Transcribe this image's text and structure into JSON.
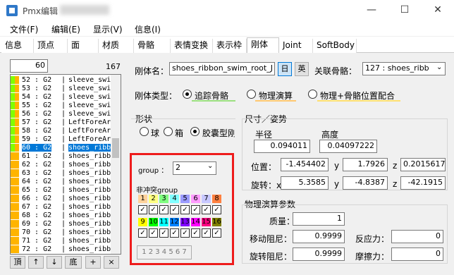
{
  "window": {
    "title": "Pmx编辑",
    "minimize": "—",
    "maximize": "☐",
    "close": "✕"
  },
  "menu": [
    "文件(F)",
    "编辑(E)",
    "显示(V)",
    "信息(I)"
  ],
  "tabs": [
    "信息",
    "顶点",
    "面",
    "材质",
    "骨骼",
    "表情变换",
    "表示枠",
    "刚体",
    "Joint",
    "SoftBody"
  ],
  "list": {
    "search_value": "60",
    "count": "167",
    "rows": [
      {
        "label": "52 : G2",
        "name": "sleeve_swi",
        "color": "#80ff00"
      },
      {
        "label": "53 : G2",
        "name": "sleeve_swi",
        "color": "#80ff00"
      },
      {
        "label": "54 : G2",
        "name": "sleeve_swi",
        "color": "#80ff00"
      },
      {
        "label": "55 : G2",
        "name": "sleeve_swi",
        "color": "#80ff00"
      },
      {
        "label": "56 : G2",
        "name": "sleeve_swi",
        "color": "#80ff00"
      },
      {
        "label": "57 : G2",
        "name": "LeftForeAr",
        "color": "#80ff00"
      },
      {
        "label": "58 : G2",
        "name": "LeftForeAr",
        "color": "#80ff00"
      },
      {
        "label": "59 : G2",
        "name": "LeftForeAr",
        "color": "#80ff00"
      },
      {
        "label": "60 : G2",
        "name": "shoes_ribb",
        "color": "#80ff00"
      },
      {
        "label": "61 : G2",
        "name": "shoes_ribb",
        "color": "#ffb400"
      },
      {
        "label": "62 : G2",
        "name": "shoes_ribb",
        "color": "#ffb400"
      },
      {
        "label": "63 : G2",
        "name": "shoes_ribb",
        "color": "#ffb400"
      },
      {
        "label": "64 : G2",
        "name": "shoes_ribb",
        "color": "#ffb400"
      },
      {
        "label": "65 : G2",
        "name": "shoes_ribb",
        "color": "#ffb400"
      },
      {
        "label": "66 : G2",
        "name": "shoes_ribb",
        "color": "#ffb400"
      },
      {
        "label": "67 : G2",
        "name": "shoes_ribb",
        "color": "#ffb400"
      },
      {
        "label": "68 : G2",
        "name": "shoes_ribb",
        "color": "#ffb400"
      },
      {
        "label": "69 : G2",
        "name": "shoes_ribb",
        "color": "#ffb400"
      },
      {
        "label": "70 : G2",
        "name": "shoes_ribb",
        "color": "#ffb400"
      },
      {
        "label": "71 : G2",
        "name": "shoes_ribb",
        "color": "#ffb400"
      },
      {
        "label": "72 : G2",
        "name": "shoes_ribb",
        "color": "#ffb400"
      }
    ],
    "selected_index": 8,
    "nav": [
      "頂",
      "↑",
      "↓",
      "底",
      "+",
      "×"
    ]
  },
  "body": {
    "name_label": "刚体名：",
    "name_value": "shoes_ribbon_swim_root_J",
    "lang_jp": "日",
    "lang_en": "英",
    "bone_label": "关联骨骼：",
    "bone_value": "127 : shoes_ribb",
    "type_label": "刚体类型：",
    "type_options": [
      "追踪骨骼",
      "物理演算",
      "物理+骨骼位置配合"
    ],
    "shape_label": "形状",
    "shapes": [
      "球",
      "箱",
      "胶囊型刚"
    ],
    "size_label": "尺寸／姿势",
    "radius_label": "半径",
    "radius": "0.094011",
    "height_label": "高度",
    "height": "0.04097222",
    "pos_label": "位置：",
    "pos": [
      "-1.454402",
      "1.7926",
      "0.2015617"
    ],
    "rot_label": "旋转：",
    "rot": [
      "5.3585",
      "-4.8387",
      "-42.1915"
    ],
    "axis": [
      "x",
      "y",
      "z"
    ],
    "group_label": "group ：",
    "group_value": "2",
    "nocollide_label": "非冲突group",
    "groups_top": [
      "1",
      "2",
      "3",
      "4",
      "5",
      "6",
      "7",
      "8"
    ],
    "groups_bottom": [
      "9",
      "10",
      "11",
      "12",
      "13",
      "14",
      "15",
      "16"
    ],
    "group_colors": [
      "#ffd29b",
      "#ffff80",
      "#80ff80",
      "#80ffff",
      "#9b9bff",
      "#ff9bff",
      "#c8c8ff",
      "#ff8040",
      "#ffff00",
      "#00ff00",
      "#00ffff",
      "#0080ff",
      "#8000ff",
      "#ff00ff",
      "#ff0080",
      "#808000"
    ],
    "group_text": "1 2 3 4 5 6 7",
    "physics_label": "物理演算参数",
    "mass_label": "质量：",
    "mass": "1",
    "move_damp_label": "移动阻尼：",
    "move_damp": "0.9999",
    "rot_damp_label": "旋转阻尼：",
    "rot_damp": "0.9999",
    "restitution_label": "反应力：",
    "restitution": "0",
    "friction_label": "摩擦力：",
    "friction": "0"
  }
}
